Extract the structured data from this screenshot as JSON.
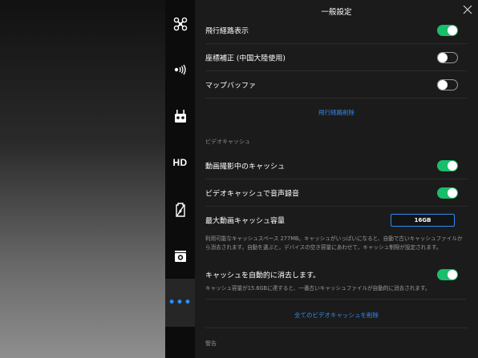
{
  "panel": {
    "title": "一般設定"
  },
  "nav": {
    "hd_label": "HD",
    "more_label": "•••",
    "accent_color": "#2d8cf0"
  },
  "settings": {
    "flight_path": {
      "label": "飛行経路表示",
      "on": true
    },
    "coord_correction": {
      "label": "座標補正 (中国大陸使用)",
      "on": false
    },
    "map_buffer": {
      "label": "マップバッファ",
      "on": false
    },
    "clear_flight_path": "飛行経路削除",
    "video_cache_header": "ビデオキャッシュ",
    "cache_while_recording": {
      "label": "動画撮影中のキャッシュ",
      "on": true
    },
    "record_audio": {
      "label": "ビデオキャッシュで音声録音",
      "on": true
    },
    "max_cache": {
      "label": "最大動画キャッシュ容量",
      "value": "16GB"
    },
    "max_cache_desc": "利用可能なキャッシュスペース 277MB。キャッシュがいっぱいになると、自動で古いキャッシュファイルから消去されます。自動を選ぶと，デバイスの空き容量にあわせて，キャッシュ制限が設定されます。",
    "auto_clear": {
      "label": "キャッシュを自動的に消去します。",
      "on": true
    },
    "auto_clear_desc": "キャッシュ容量が15.6GBに達すると、一番古いキャッシュファイルが自動的に消去されます。",
    "clear_all_cache": "全てのビデオキャッシュを削除",
    "warning_header": "警告"
  },
  "colors": {
    "toggle_on": "#19be6b",
    "link": "#2d8cf0"
  }
}
